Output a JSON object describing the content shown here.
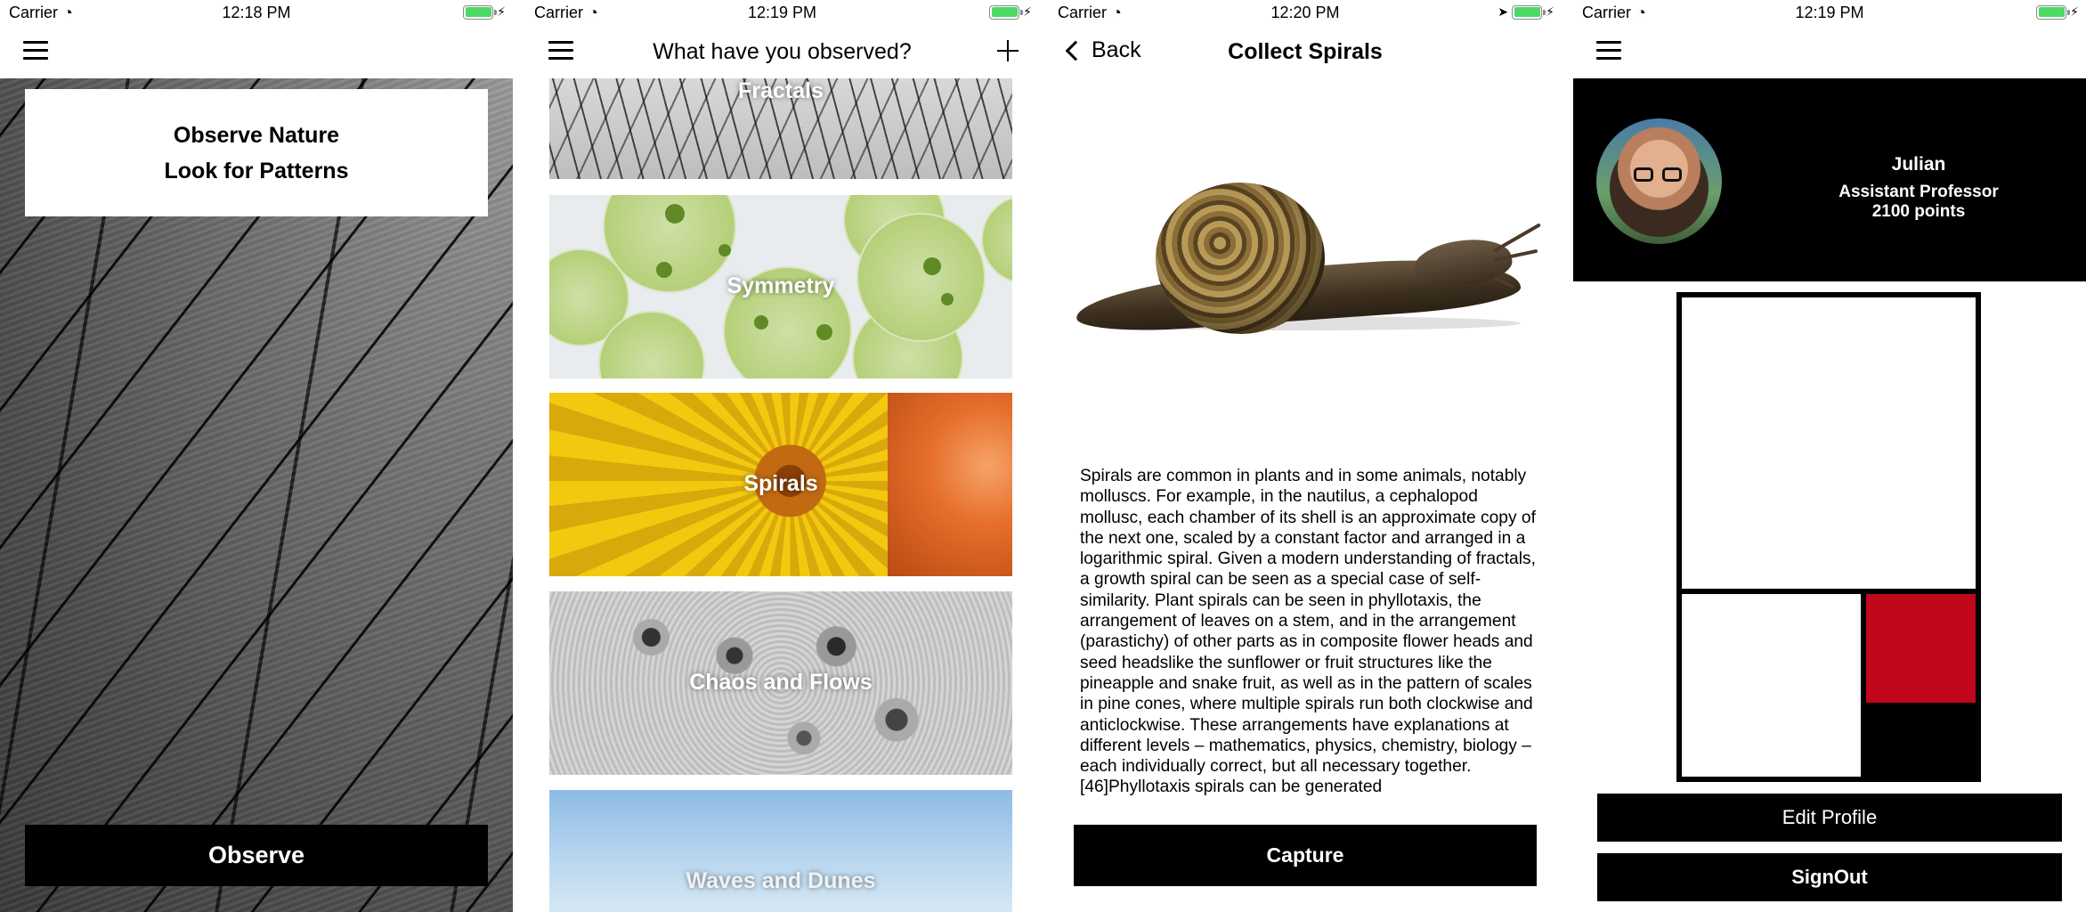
{
  "status_bars": [
    {
      "carrier": "Carrier",
      "time": "12:18 PM"
    },
    {
      "carrier": "Carrier",
      "time": "12:19 PM"
    },
    {
      "carrier": "Carrier",
      "time": "12:20 PM"
    },
    {
      "carrier": "Carrier",
      "time": "12:19 PM"
    }
  ],
  "home": {
    "line1": "Observe Nature",
    "line2": "Look for Patterns",
    "observe_button": "Observe",
    "menu_icon": "hamburger-menu-icon"
  },
  "categories": {
    "title": "What have you observed?",
    "add_icon": "plus-icon",
    "items": [
      {
        "label": "Fractals"
      },
      {
        "label": "Symmetry"
      },
      {
        "label": "Spirals"
      },
      {
        "label": "Chaos and Flows"
      },
      {
        "label": "Waves and Dunes"
      }
    ]
  },
  "detail": {
    "back_label": "Back",
    "title": "Collect Spirals",
    "description": "Spirals are common in plants and in some animals, notably molluscs. For example, in the nautilus, a cephalopod mollusc, each chamber of its shell is an approximate copy of the next one, scaled by a constant factor and arranged in a logarithmic spiral. Given a modern understanding of fractals, a growth spiral can be seen as a special case of self-similarity. Plant spirals can be seen in phyllotaxis, the arrangement of leaves on a stem, and in the arrangement (parastichy) of other parts as in composite flower heads and seed headslike the sunflower or fruit structures like the pineapple and snake fruit, as well as in the pattern of scales in pine cones, where multiple spirals run both clockwise and anticlockwise. These arrangements have explanations at different levels – mathematics, physics, chemistry, biology – each individually correct, but all necessary together.[46]Phyllotaxis spirals can be generated",
    "capture_button": "Capture"
  },
  "profile": {
    "name": "Julian",
    "title": "Assistant Professor",
    "points": "2100 points",
    "edit_button": "Edit Profile",
    "signout_button": "SignOut",
    "accent_red": "#c0071c"
  }
}
